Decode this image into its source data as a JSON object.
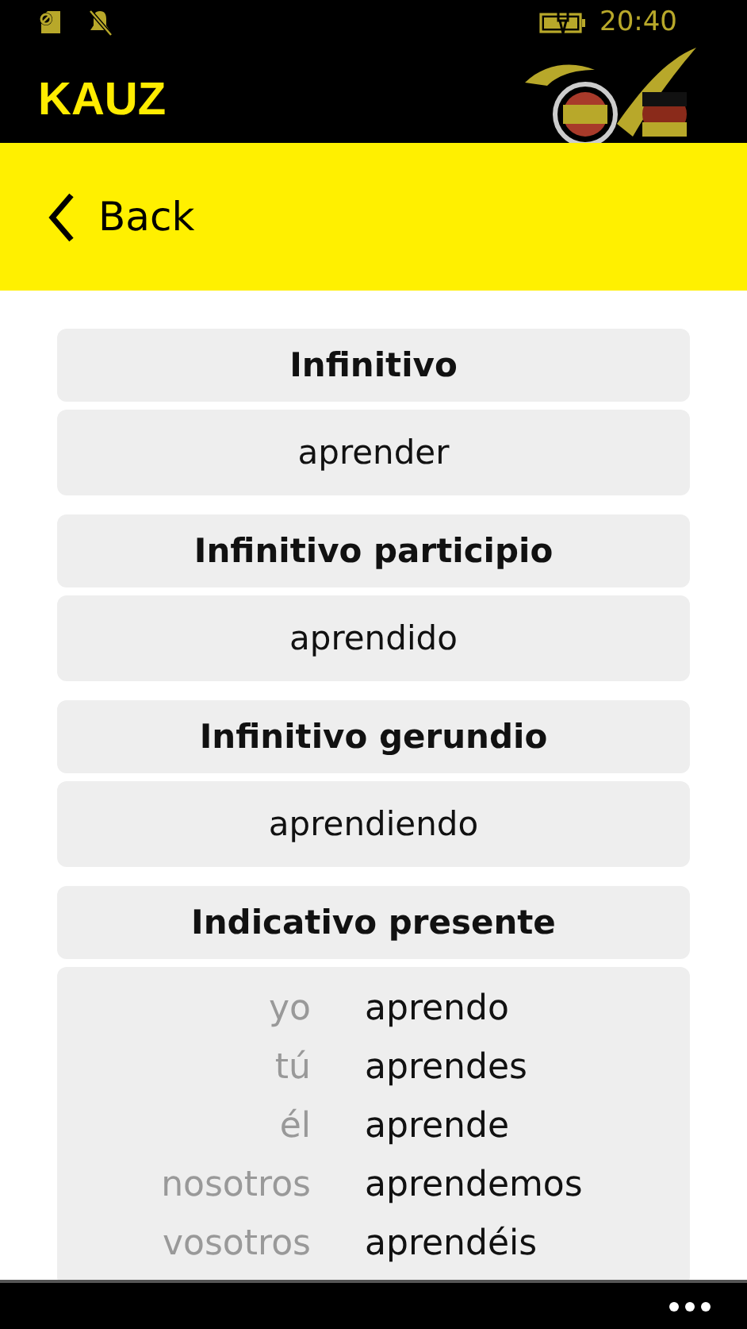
{
  "status_bar": {
    "time": "20:40"
  },
  "app": {
    "title": "KAUZ"
  },
  "nav": {
    "back_label": "Back"
  },
  "sections": [
    {
      "title": "Infinitivo",
      "kind": "single",
      "value": "aprender"
    },
    {
      "title": "Infinitivo participio",
      "kind": "single",
      "value": "aprendido"
    },
    {
      "title": "Infinitivo gerundio",
      "kind": "single",
      "value": "aprendiendo"
    },
    {
      "title": "Indicativo presente",
      "kind": "table",
      "rows": [
        {
          "pronoun": "yo",
          "form": "aprendo"
        },
        {
          "pronoun": "tú",
          "form": "aprendes"
        },
        {
          "pronoun": "él",
          "form": "aprende"
        },
        {
          "pronoun": "nosotros",
          "form": "aprendemos"
        },
        {
          "pronoun": "vosotros",
          "form": "aprendéis"
        }
      ]
    }
  ]
}
